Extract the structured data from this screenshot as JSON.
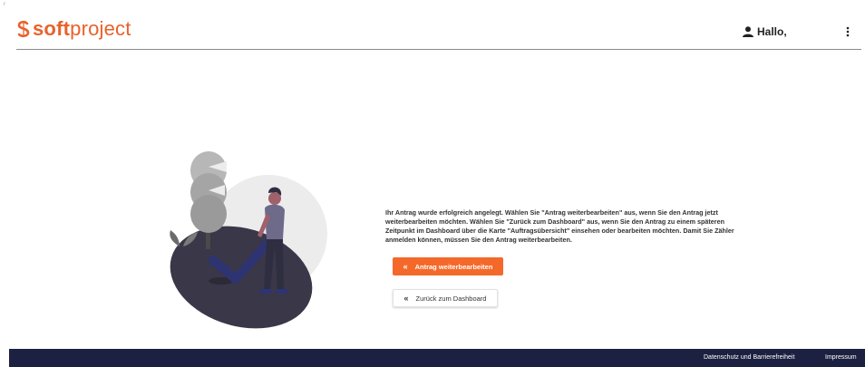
{
  "corner_mark": "r",
  "brand": {
    "name_bold": "soft",
    "name_regular": "project",
    "color": "#e8622a"
  },
  "header": {
    "greeting": "Hallo,"
  },
  "main": {
    "message": "Ihr Antrag wurde erfolgreich angelegt. Wählen Sie \"Antrag weiterbearbeiten\" aus, wenn Sie den Antrag jetzt weiterbearbeiten möchten. Wählen Sie \"Zurück zum Dashboard\" aus, wenn Sie den Antrag zu einem späteren Zeitpunkt im Dashboard über die Karte \"Auftragsübersicht\" einsehen oder bearbeiten möchten. Damit Sie Zähler anmelden können, müssen Sie den Antrag weiterbearbeiten.",
    "primary_button": "Antrag weiterbearbeiten",
    "secondary_button": "Zurück zum Dashboard"
  },
  "footer": {
    "privacy_link": "Datenschutz und Barrierefreiheit",
    "imprint_link": "Impressum",
    "background": "#1d2141"
  },
  "colors": {
    "accent": "#f4692a"
  },
  "icons": [
    "user-icon",
    "kebab-menu-icon",
    "chevron-double-left-icon",
    "success-illustration"
  ]
}
